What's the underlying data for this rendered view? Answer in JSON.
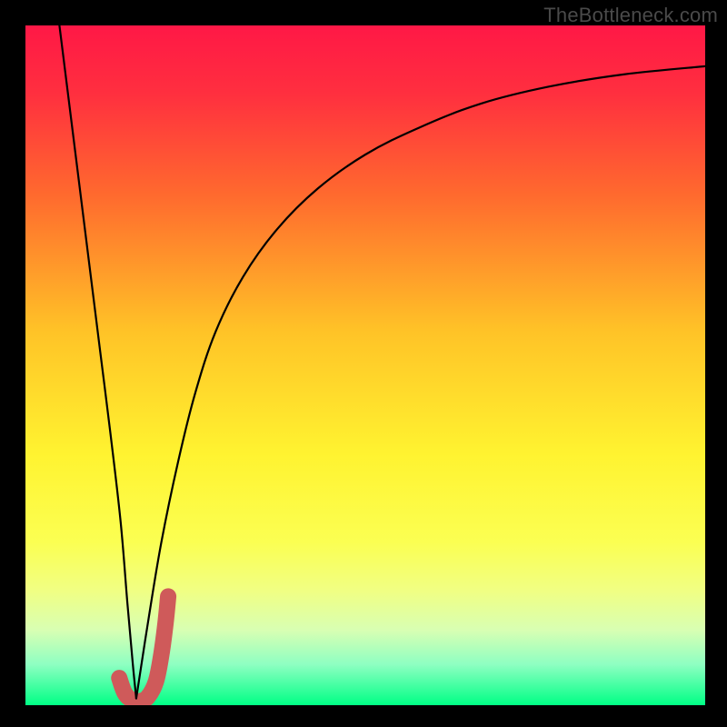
{
  "watermark": "TheBottleneck.com",
  "chart_data": {
    "type": "line",
    "title": "",
    "xlabel": "",
    "ylabel": "",
    "xlim": [
      0,
      100
    ],
    "ylim": [
      0,
      100
    ],
    "grid": false,
    "legend": false,
    "gradient_stops": [
      {
        "offset": 0,
        "color": "#ff1846"
      },
      {
        "offset": 0.1,
        "color": "#ff2f3f"
      },
      {
        "offset": 0.25,
        "color": "#ff6a2e"
      },
      {
        "offset": 0.45,
        "color": "#ffc327"
      },
      {
        "offset": 0.63,
        "color": "#fff330"
      },
      {
        "offset": 0.76,
        "color": "#fbff52"
      },
      {
        "offset": 0.83,
        "color": "#f1ff82"
      },
      {
        "offset": 0.89,
        "color": "#d8ffb3"
      },
      {
        "offset": 0.94,
        "color": "#8effc2"
      },
      {
        "offset": 1.0,
        "color": "#00ff85"
      }
    ],
    "series": [
      {
        "name": "left-branch",
        "stroke": "#000000",
        "stroke_width": 2.2,
        "x": [
          5.0,
          6.5,
          8.0,
          9.5,
          11.0,
          12.5,
          14.0,
          15.0,
          15.8,
          16.3
        ],
        "y": [
          100,
          88,
          76,
          64,
          52,
          40,
          27,
          15,
          6,
          1
        ]
      },
      {
        "name": "right-branch",
        "stroke": "#000000",
        "stroke_width": 2.2,
        "x": [
          16.3,
          18.0,
          20.0,
          22.5,
          25.0,
          28.0,
          32.0,
          37.0,
          43.0,
          50.0,
          58.0,
          67.0,
          77.0,
          88.0,
          100.0
        ],
        "y": [
          1,
          12,
          24,
          36,
          46,
          55,
          63,
          70,
          76,
          81,
          85,
          88.5,
          91,
          92.8,
          94
        ]
      },
      {
        "name": "j-mark",
        "stroke": "#cf5a5a",
        "stroke_width": 18,
        "linecap": "round",
        "x": [
          13.8,
          14.6,
          15.6,
          16.8,
          18.0,
          19.2,
          20.0,
          20.6,
          21.0
        ],
        "y": [
          4.0,
          1.8,
          0.8,
          0.6,
          1.2,
          3.5,
          7.5,
          12.0,
          16.0
        ]
      }
    ]
  }
}
